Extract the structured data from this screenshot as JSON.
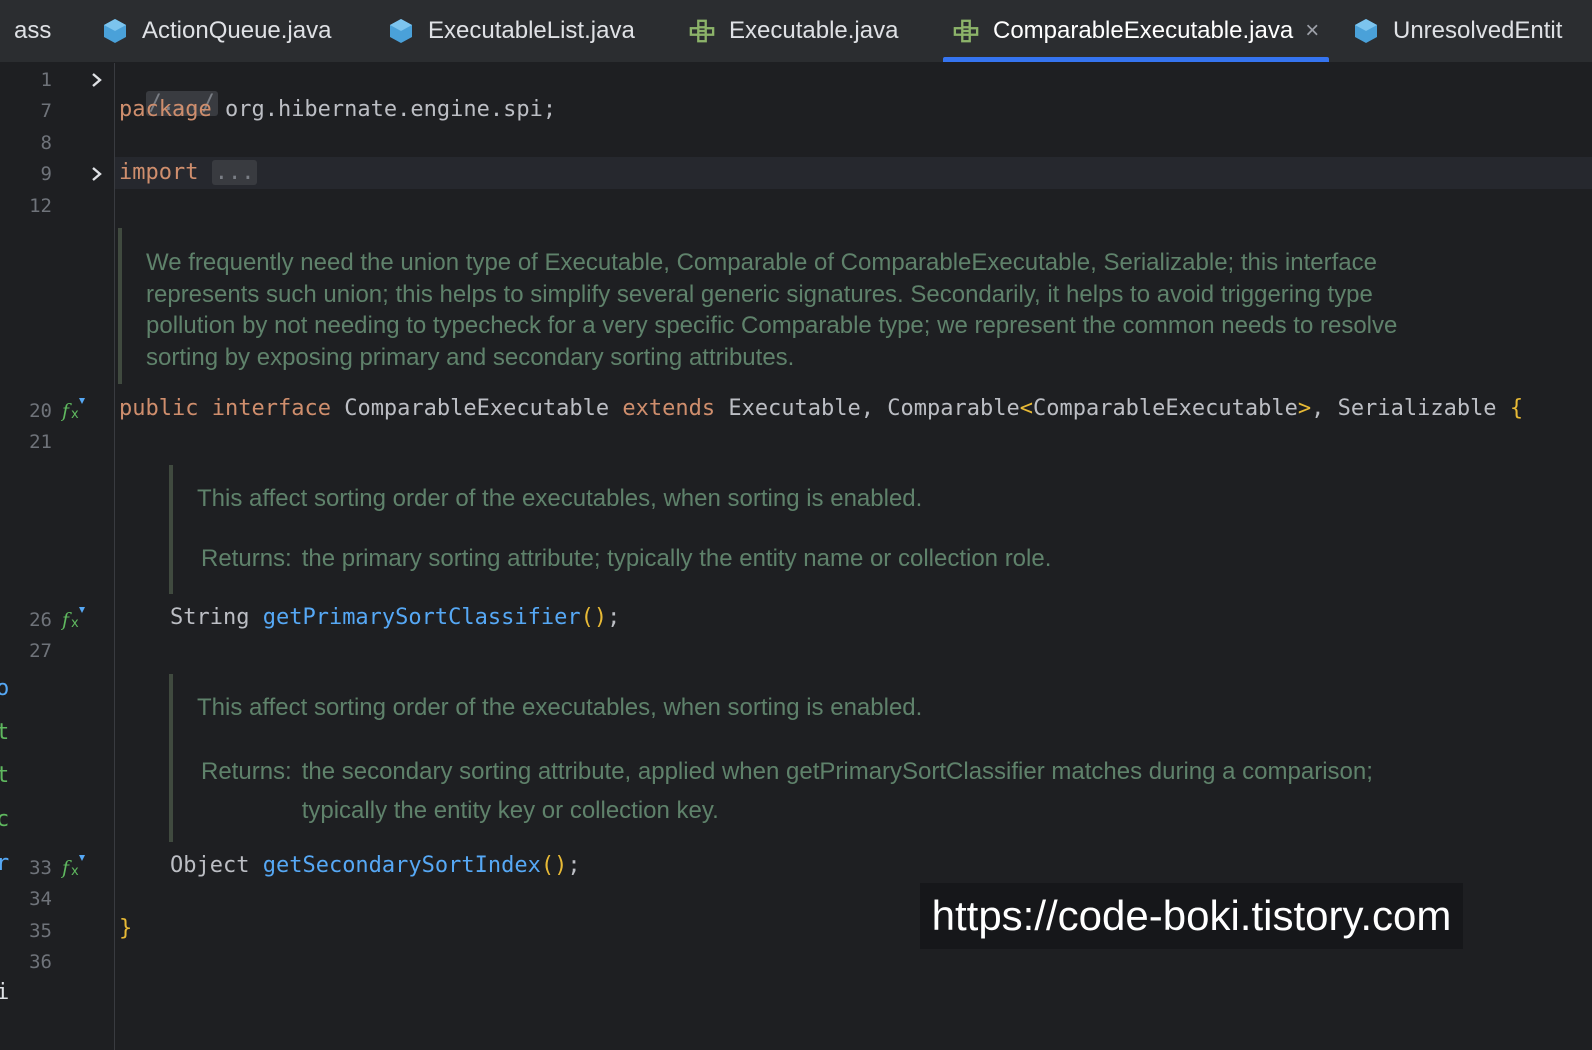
{
  "tabs": [
    {
      "label": "ass",
      "icon": "none",
      "active": false
    },
    {
      "label": "ActionQueue.java",
      "icon": "java-class-icon",
      "active": false
    },
    {
      "label": "ExecutableList.java",
      "icon": "java-class-icon",
      "active": false
    },
    {
      "label": "Executable.java",
      "icon": "interface-icon",
      "active": false
    },
    {
      "label": "ComparableExecutable.java",
      "icon": "interface-icon",
      "active": true,
      "close": "×"
    },
    {
      "label": "UnresolvedEntit",
      "icon": "java-class-icon",
      "active": false
    }
  ],
  "editor": {
    "line_numbers": [
      "1",
      "7",
      "8",
      "9",
      "12",
      "20",
      "21",
      "26",
      "27",
      "33",
      "34",
      "35",
      "36"
    ],
    "fold_header": "/.../",
    "package_kw": "package",
    "package_name": " org.hibernate.engine.spi;",
    "import_kw": "import",
    "import_fold": "...",
    "class_doc": "We frequently need the union type of Executable, Comparable of ComparableExecutable, Serializable; this interface represents such union; this helps to simplify several generic signatures. Secondarily, it helps to avoid triggering type pollution by not needing to typecheck for a very specific Comparable type; we represent the common needs to resolve sorting by exposing primary and secondary sorting attributes.",
    "decl": {
      "public": "public",
      "interface": "interface",
      "name": " ComparableExecutable ",
      "extends": "extends",
      "types1": " Executable, Comparable",
      "lt": "<",
      "generic": "ComparableExecutable",
      "gt": ">",
      "types2": ", Serializable ",
      "open": "{"
    },
    "method1_doc": "This affect sorting order of the executables, when sorting is enabled.",
    "method1_returns_label": "Returns:",
    "method1_returns": "the primary sorting attribute; typically the entity name or collection role.",
    "method1_type": "String ",
    "method1_name": "getPrimarySortClassifier",
    "method2_doc": "This affect sorting order of the executables, when sorting is enabled.",
    "method2_returns_label": "Returns:",
    "method2_returns": "the secondary sorting attribute, applied when getPrimarySortClassifier matches during a comparison; typically the entity key or collection key.",
    "method2_type": "Object ",
    "method2_name": "getSecondarySortIndex",
    "parens": "()",
    "semicolon": ";",
    "close_brace": "}"
  },
  "left_edge_glyphs": [
    "o",
    "t",
    "t",
    "c",
    "r",
    "i"
  ],
  "watermark": "https://code-boki.tistory.com",
  "colors": {
    "keyword": "#cf8e6d",
    "function": "#56a8f5",
    "brace": "#e8ba36",
    "doc": "#5f826b",
    "accent": "#3574f0"
  }
}
